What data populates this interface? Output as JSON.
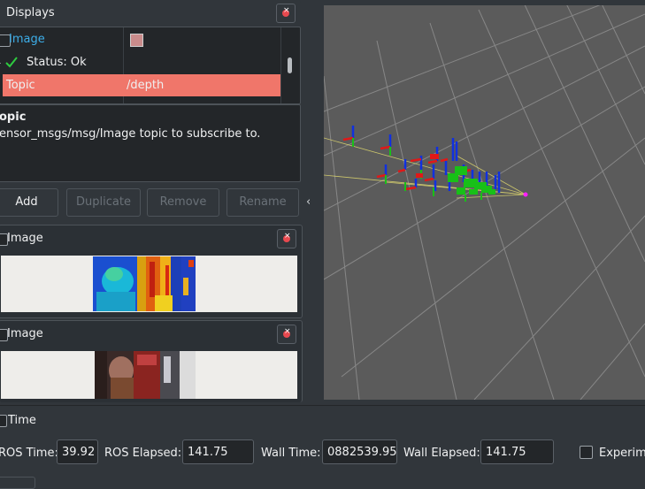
{
  "displays_panel": {
    "title": "Displays",
    "tree": {
      "image_label": "Image",
      "status_label": "Status: Ok",
      "topic_label": "Topic",
      "topic_value": "/depth"
    },
    "description": {
      "title": "opic",
      "text": "ensor_msgs/msg/Image topic to subscribe to."
    },
    "buttons": {
      "add": "Add",
      "duplicate": "Duplicate",
      "remove": "Remove",
      "rename": "Rename"
    }
  },
  "image_panels": [
    {
      "title": "Image"
    },
    {
      "title": "Image"
    }
  ],
  "time_panel": {
    "title": "Time",
    "ros_time_label": "ROS Time:",
    "ros_time_value": "39.92",
    "ros_elapsed_label": "ROS Elapsed:",
    "ros_elapsed_value": "141.75",
    "wall_time_label": "Wall Time:",
    "wall_time_value": "0882539.95",
    "wall_elapsed_label": "Wall Elapsed:",
    "wall_elapsed_value": "141.75",
    "experimental_label": "Experime"
  },
  "colors": {
    "accent": "#3daee9",
    "selection": "#f0766a",
    "window_bg": "#31363b",
    "viewport_bg": "#5b5b5b"
  }
}
